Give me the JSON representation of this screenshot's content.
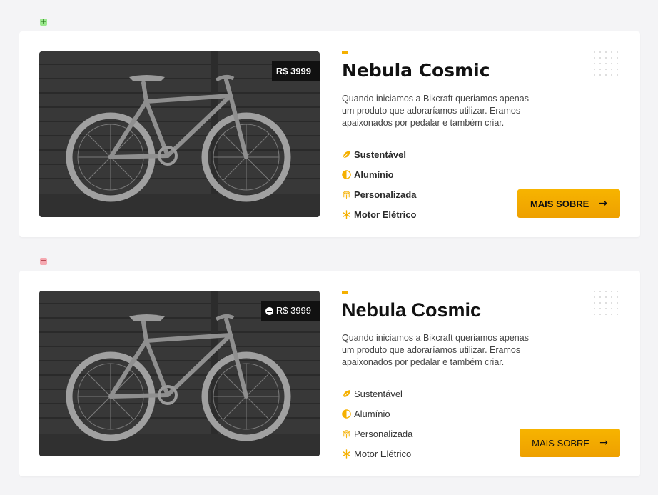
{
  "diff": {
    "added_symbol": "+",
    "removed_symbol": "−",
    "added_color": "#9be88e",
    "removed_color": "#f5a9b1"
  },
  "cards": [
    {
      "variant": "bold",
      "price": "R$ 3999",
      "title": "Nebula Cosmic",
      "description": "Quando iniciamos a Bikcraft queriamos apenas um produto que adoraríamos utilizar. Eramos apaixonados por pedalar e também criar.",
      "features": [
        {
          "icon": "leaf-icon",
          "label": "Sustentável"
        },
        {
          "icon": "half-circle-icon",
          "label": "Alumínio"
        },
        {
          "icon": "fingerprint-icon",
          "label": "Personalizada"
        },
        {
          "icon": "snowflake-icon",
          "label": "Motor Elétrico"
        }
      ],
      "button_label": "MAIS SOBRE",
      "button_arrow": "→"
    },
    {
      "variant": "regular",
      "price": "R$ 3999",
      "title": "Nebula Cosmic",
      "description": "Quando iniciamos a Bikcraft queriamos apenas um produto que adoraríamos utilizar. Eramos apaixonados por pedalar e também criar.",
      "features": [
        {
          "icon": "leaf-icon",
          "label": "Sustentável"
        },
        {
          "icon": "half-circle-icon",
          "label": "Alumínio"
        },
        {
          "icon": "fingerprint-icon",
          "label": "Personalizada"
        },
        {
          "icon": "snowflake-icon",
          "label": "Motor Elétrico"
        }
      ],
      "button_label": "MAIS SOBRE",
      "button_arrow": "→"
    }
  ],
  "colors": {
    "accent": "#f5b000",
    "background": "#f4f4f6",
    "card": "#ffffff",
    "price_tag": "#111111"
  }
}
